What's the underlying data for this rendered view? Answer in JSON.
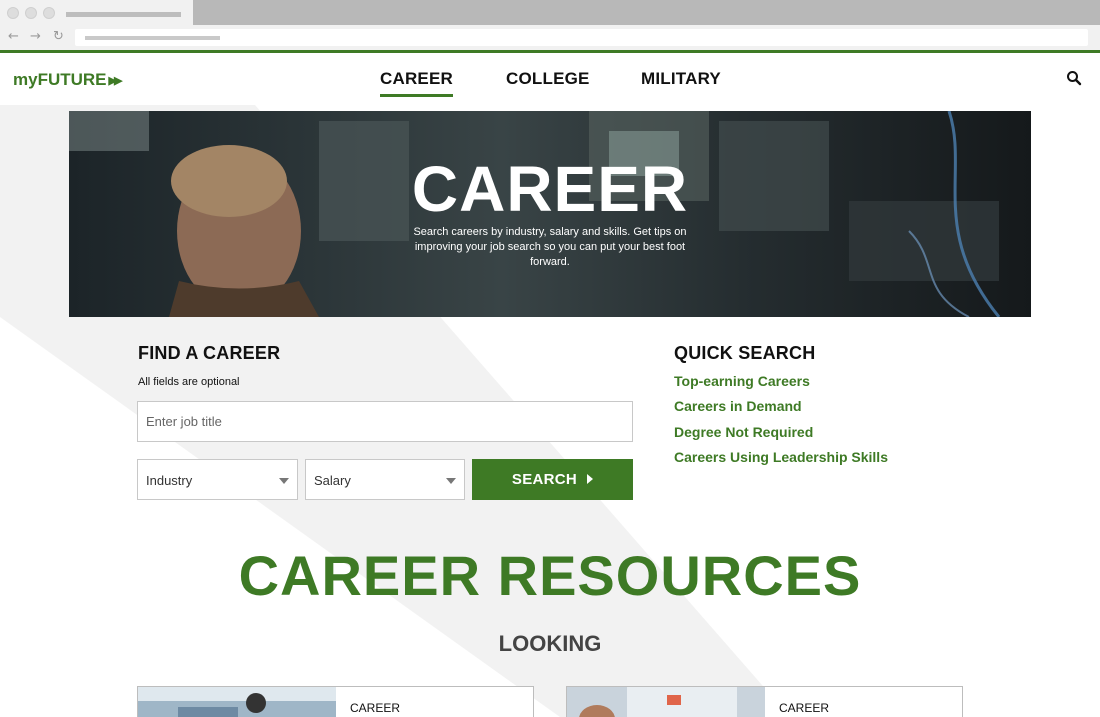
{
  "browser": {
    "back_icon": "arrow-left-icon",
    "forward_icon": "arrow-right-icon",
    "reload_icon": "reload-icon"
  },
  "header": {
    "logo_text": "myFUTURE",
    "logo_arrows": "▶▶",
    "nav": [
      {
        "label": "CAREER",
        "active": true
      },
      {
        "label": "COLLEGE",
        "active": false
      },
      {
        "label": "MILITARY",
        "active": false
      }
    ],
    "search_icon": "search-icon"
  },
  "hero": {
    "title": "CAREER",
    "description": "Search careers by industry, salary and skills. Get tips on improving your job search so you can put your best foot forward."
  },
  "find_career": {
    "title": "FIND A CAREER",
    "note": "All fields are optional",
    "job_placeholder": "Enter job title",
    "industry_value": "Industry",
    "salary_value": "Salary",
    "search_label": "SEARCH"
  },
  "quick_search": {
    "title": "QUICK SEARCH",
    "links": [
      "Top-earning Careers",
      "Careers in Demand",
      "Degree Not Required",
      "Careers Using Leadership Skills"
    ]
  },
  "resources": {
    "title": "CAREER RESOURCES",
    "subtitle": "LOOKING",
    "cards": [
      {
        "label": "CAREER"
      },
      {
        "label": "CAREER"
      }
    ]
  },
  "colors": {
    "brand_green": "#3e7a25",
    "band_gray": "#f2f2f2"
  }
}
